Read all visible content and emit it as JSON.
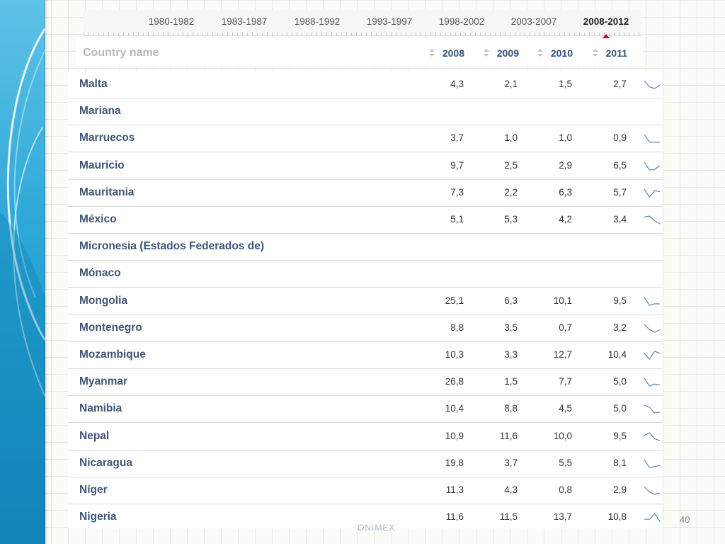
{
  "periods": [
    "1980-1982",
    "1983-1987",
    "1988-1992",
    "1993-1997",
    "1998-2002",
    "2003-2007",
    "2008-2012"
  ],
  "active_period": "2008-2012",
  "header": {
    "country": "Country name",
    "years": [
      "2008",
      "2009",
      "2010",
      "2011"
    ]
  },
  "rows": [
    {
      "name": "Malta",
      "values": [
        "4,3",
        "2,1",
        "1,5",
        "2,7"
      ]
    },
    {
      "name": "Mariana",
      "values": [
        "",
        "",
        "",
        ""
      ]
    },
    {
      "name": "Marruecos",
      "values": [
        "3,7",
        "1,0",
        "1,0",
        "0,9"
      ]
    },
    {
      "name": "Mauricio",
      "values": [
        "9,7",
        "2,5",
        "2,9",
        "6,5"
      ]
    },
    {
      "name": "Mauritania",
      "values": [
        "7,3",
        "2,2",
        "6,3",
        "5,7"
      ]
    },
    {
      "name": "México",
      "values": [
        "5,1",
        "5,3",
        "4,2",
        "3,4"
      ]
    },
    {
      "name": "Micronesia (Estados Federados de)",
      "values": [
        "",
        "",
        "",
        ""
      ]
    },
    {
      "name": "Mónaco",
      "values": [
        "",
        "",
        "",
        ""
      ]
    },
    {
      "name": "Mongolia",
      "values": [
        "25,1",
        "6,3",
        "10,1",
        "9,5"
      ]
    },
    {
      "name": "Montenegro",
      "values": [
        "8,8",
        "3,5",
        "0,7",
        "3,2"
      ]
    },
    {
      "name": "Mozambique",
      "values": [
        "10,3",
        "3,3",
        "12,7",
        "10,4"
      ]
    },
    {
      "name": "Myanmar",
      "values": [
        "26,8",
        "1,5",
        "7,7",
        "5,0"
      ]
    },
    {
      "name": "Namibia",
      "values": [
        "10,4",
        "8,8",
        "4,5",
        "5,0"
      ]
    },
    {
      "name": "Nepal",
      "values": [
        "10,9",
        "11,6",
        "10,0",
        "9,5"
      ]
    },
    {
      "name": "Nicaragua",
      "values": [
        "19,8",
        "3,7",
        "5,5",
        "8,1"
      ]
    },
    {
      "name": "Níger",
      "values": [
        "11,3",
        "4,3",
        "0,8",
        "2,9"
      ]
    },
    {
      "name": "Nigeria",
      "values": [
        "11,6",
        "11,5",
        "13,7",
        "10,8"
      ]
    }
  ],
  "page_number": "40",
  "footer_text": "ONIMEX",
  "colors": {
    "country_text": "#3f5678",
    "year_header": "#33507a",
    "active_marker": "#b40f2a",
    "sparkline": "#5a86b5"
  },
  "icons": {
    "sort": "sort-updown-icon",
    "sparkline": "sparkline-icon"
  }
}
